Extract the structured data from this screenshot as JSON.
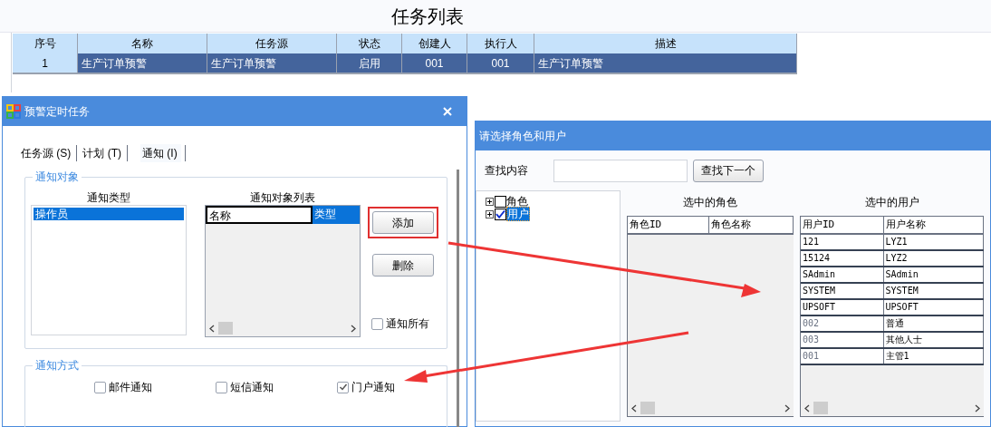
{
  "page_title": "任务列表",
  "task_table": {
    "columns": [
      "序号",
      "名称",
      "任务源",
      "状态",
      "创建人",
      "执行人",
      "描述"
    ],
    "rows": [
      {
        "selected": true,
        "cells": [
          "1",
          "生产订单预警",
          "生产订单预警",
          "启用",
          "001",
          "001",
          "生产订单预警"
        ]
      }
    ]
  },
  "schedule_dialog": {
    "title": "预警定时任务",
    "tabs": [
      {
        "label": "任务源 (S)",
        "selected": false
      },
      {
        "label": "计划 (T)",
        "selected": false
      },
      {
        "label": "通知 (I)",
        "selected": true
      }
    ],
    "target_group": {
      "title": "通知对象",
      "type_list": {
        "header": "通知类型",
        "items": [
          {
            "label": "操作员",
            "selected": true
          }
        ]
      },
      "target_list": {
        "header": "通知对象列表",
        "columns": [
          {
            "label": "名称",
            "selected": false
          },
          {
            "label": "类型",
            "selected": true
          }
        ]
      },
      "buttons": [
        {
          "label": "添加",
          "highlighted": true
        },
        {
          "label": "删除",
          "highlighted": false
        }
      ],
      "notify_all": {
        "label": "通知所有",
        "checked": false
      }
    },
    "method_group": {
      "title": "通知方式",
      "options": [
        {
          "label": "邮件通知",
          "checked": false
        },
        {
          "label": "短信通知",
          "checked": false
        },
        {
          "label": "门户通知",
          "checked": true
        }
      ]
    }
  },
  "select_dialog": {
    "title": "请选择角色和用户",
    "search": {
      "label": "查找内容",
      "button": "查找下一个"
    },
    "tree": [
      {
        "label": "角色",
        "expanded": false,
        "checked": false,
        "selected": false
      },
      {
        "label": "用户",
        "expanded": false,
        "checked": true,
        "selected": true
      }
    ],
    "roles": {
      "title": "选中的角色",
      "columns": [
        "角色ID",
        "角色名称"
      ]
    },
    "users": {
      "title": "选中的用户",
      "columns": [
        "用户ID",
        "用户名称"
      ],
      "rows": [
        {
          "greyed": false,
          "cells": [
            "121",
            "LYZ1"
          ]
        },
        {
          "greyed": false,
          "cells": [
            "15124",
            "LYZ2"
          ]
        },
        {
          "greyed": false,
          "cells": [
            "SAdmin",
            "SAdmin"
          ]
        },
        {
          "greyed": false,
          "cells": [
            "SYSTEM",
            "SYSTEM"
          ]
        },
        {
          "greyed": false,
          "cells": [
            "UPSOFT",
            "UPSOFT"
          ]
        },
        {
          "greyed": true,
          "cells": [
            "002",
            "普通"
          ]
        },
        {
          "greyed": true,
          "cells": [
            "003",
            "其他人士"
          ]
        },
        {
          "greyed": true,
          "cells": [
            "001",
            "主管1"
          ]
        }
      ]
    }
  }
}
